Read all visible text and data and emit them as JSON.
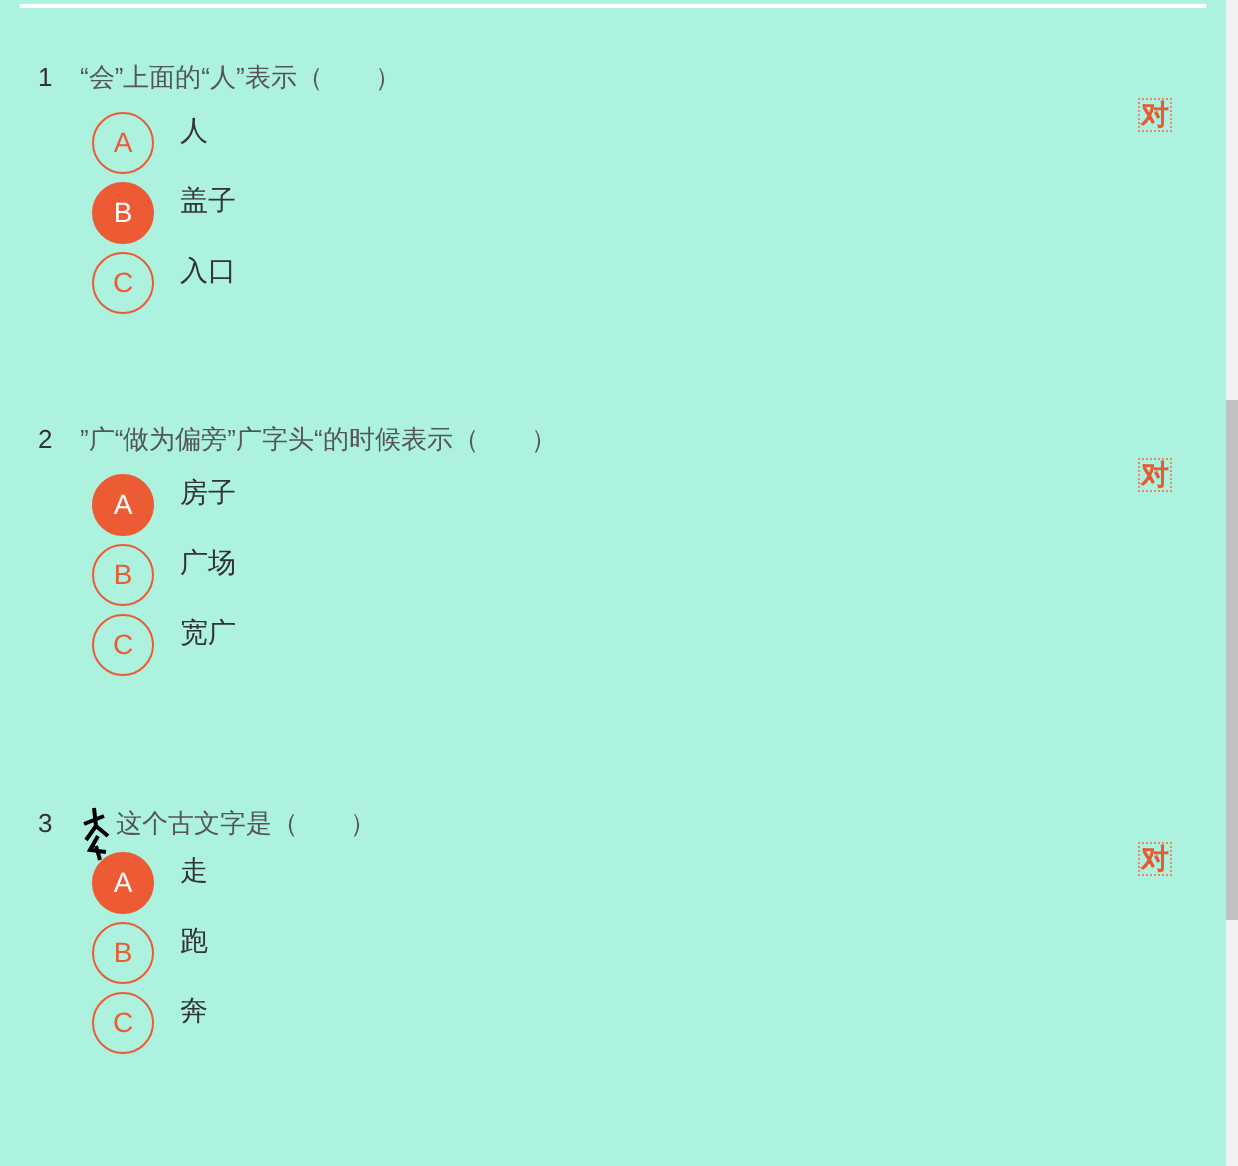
{
  "questions": [
    {
      "number": "1",
      "kind": "text",
      "text": "“会”上面的“人”表示（　　）",
      "mark": "对",
      "options": [
        {
          "letter": "A",
          "text": "人",
          "selected": false
        },
        {
          "letter": "B",
          "text": "盖子",
          "selected": true
        },
        {
          "letter": "C",
          "text": "入口",
          "selected": false
        }
      ]
    },
    {
      "number": "2",
      "kind": "text",
      "text": "”广“做为偏旁”广字头“的时候表示（　　）",
      "mark": "对",
      "options": [
        {
          "letter": "A",
          "text": "房子",
          "selected": true
        },
        {
          "letter": "B",
          "text": "广场",
          "selected": false
        },
        {
          "letter": "C",
          "text": "宽广",
          "selected": false
        }
      ]
    },
    {
      "number": "3",
      "kind": "glyph",
      "text": "这个古文字是（　　）",
      "mark": "对",
      "options": [
        {
          "letter": "A",
          "text": "走",
          "selected": true
        },
        {
          "letter": "B",
          "text": "跑",
          "selected": false
        },
        {
          "letter": "C",
          "text": "奔",
          "selected": false
        }
      ]
    }
  ]
}
